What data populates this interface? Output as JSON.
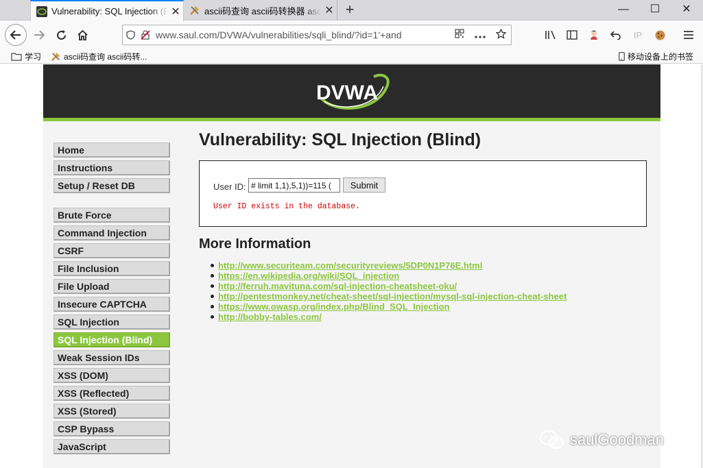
{
  "browser": {
    "tabs": [
      {
        "title": "Vulnerability: SQL Injection (Blind)",
        "active": true
      },
      {
        "title": "ascii码查询 ascii码转换器 ascii码表",
        "active": false
      }
    ],
    "new_tab": "+",
    "close_glyph": "✕",
    "window_controls": {
      "minimize": "—",
      "maximize": "☐",
      "close": "✕"
    },
    "url": "www.saul.com/DVWA/vulnerabilities/sqli_blind/?id=1'+and",
    "bookmarks": [
      {
        "label": "学习",
        "icon": "folder-icon"
      },
      {
        "label": "ascii码查询 ascii码转...",
        "icon": "tools-icon"
      }
    ],
    "mobile_bookmarks": "移动设备上的书签",
    "ip_label": "IP"
  },
  "dvwa": {
    "logo_text": "DVWA",
    "menu": {
      "group1": [
        "Home",
        "Instructions",
        "Setup / Reset DB"
      ],
      "group2": [
        "Brute Force",
        "Command Injection",
        "CSRF",
        "File Inclusion",
        "File Upload",
        "Insecure CAPTCHA",
        "SQL Injection",
        "SQL Injection (Blind)",
        "Weak Session IDs",
        "XSS (DOM)",
        "XSS (Reflected)",
        "XSS (Stored)",
        "CSP Bypass",
        "JavaScript"
      ],
      "selected": "SQL Injection (Blind)"
    },
    "page_title": "Vulnerability: SQL Injection (Blind)",
    "form": {
      "label": "User ID:",
      "value": ") limit 1,1),5,1))=115 #",
      "submit": "Submit"
    },
    "result": "User ID exists in the database.",
    "more_info_title": "More Information",
    "links": [
      "http://www.securiteam.com/securityreviews/5DP0N1P76E.html",
      "https://en.wikipedia.org/wiki/SQL_injection",
      "http://ferruh.mavituna.com/sql-injection-cheatsheet-oku/",
      "http://pentestmonkey.net/cheat-sheet/sql-injection/mysql-sql-injection-cheat-sheet",
      "https://www.owasp.org/index.php/Blind_SQL_Injection",
      "http://bobby-tables.com/"
    ]
  },
  "watermark": "saulGoodman",
  "colors": {
    "accent": "#8cc63f",
    "header": "#2a2a2a",
    "error": "#cc0000",
    "tab_highlight": "#0a84ff"
  }
}
